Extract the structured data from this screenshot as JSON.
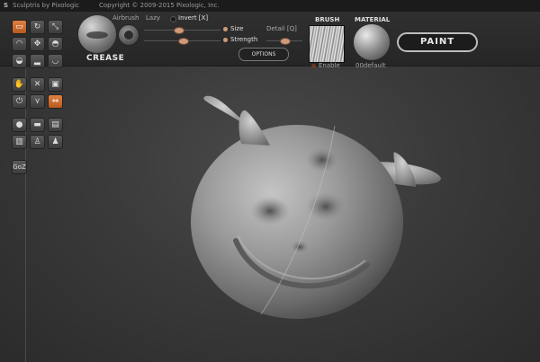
{
  "titlebar": {
    "logo": "S",
    "app_title": "Sculptris by Pixologic",
    "copyright": "Copyright © 2009-2015 Pixologic, Inc."
  },
  "brush": {
    "name": "CREASE",
    "airbrush_label": "Airbrush",
    "lazy_label": "Lazy",
    "invert_label": "Invert [X]",
    "size_label": "Size",
    "strength_label": "Strength",
    "detail_label": "Detail [Q]",
    "options_label": "OPTIONS",
    "size_value": 0.45,
    "strength_value": 0.5
  },
  "brush_panel": {
    "heading": "BRUSH",
    "enable_label": "Enable"
  },
  "material_panel": {
    "heading": "MATERIAL",
    "name": "00default"
  },
  "paint_button": "PAINT",
  "goz_label": "GoZ",
  "colors": {
    "accent": "#e07a3c",
    "toolbar": "#2a2a2a",
    "titlebar": "#1b1b1b",
    "background": "#3a3a3a",
    "model": "#9b9b9b"
  },
  "tools": [
    {
      "name": "crease-tool-icon",
      "glyph": "▭",
      "active": true
    },
    {
      "name": "rotate-tool-icon",
      "glyph": "↻",
      "active": false
    },
    {
      "name": "scale-tool-icon",
      "glyph": "⤡",
      "active": false
    },
    {
      "name": "draw-tool-icon",
      "glyph": "◠",
      "active": false
    },
    {
      "name": "move-tool-icon",
      "glyph": "✥",
      "active": false
    },
    {
      "name": "inflate-tool-icon",
      "glyph": "◓",
      "active": false
    },
    {
      "name": "pinch-tool-icon",
      "glyph": "◒",
      "active": false
    },
    {
      "name": "flatten-tool-icon",
      "glyph": "▂",
      "active": false
    },
    {
      "name": "smooth-tool-icon",
      "glyph": "◡",
      "active": false
    },
    {
      "name": "grab-tool-icon",
      "glyph": "✋",
      "active": false
    },
    {
      "name": "reduce-tool-icon",
      "glyph": "✕",
      "active": false
    },
    {
      "name": "mask-tool-icon",
      "glyph": "▣",
      "active": false
    },
    {
      "name": "power-icon",
      "glyph": "⏻",
      "active": false
    },
    {
      "name": "wireframe-icon",
      "glyph": "⋎",
      "active": false
    },
    {
      "name": "symmetry-icon",
      "glyph": "⇔",
      "active": true
    },
    {
      "name": "sphere-icon",
      "glyph": "●",
      "active": false
    },
    {
      "name": "plane-icon",
      "glyph": "▬",
      "active": false
    },
    {
      "name": "camera-icon",
      "glyph": "▤",
      "active": false
    },
    {
      "name": "settings-icon",
      "glyph": "▥",
      "active": false
    },
    {
      "name": "person-icon",
      "glyph": "♙",
      "active": false
    },
    {
      "name": "group-icon",
      "glyph": "♟",
      "active": false
    }
  ]
}
